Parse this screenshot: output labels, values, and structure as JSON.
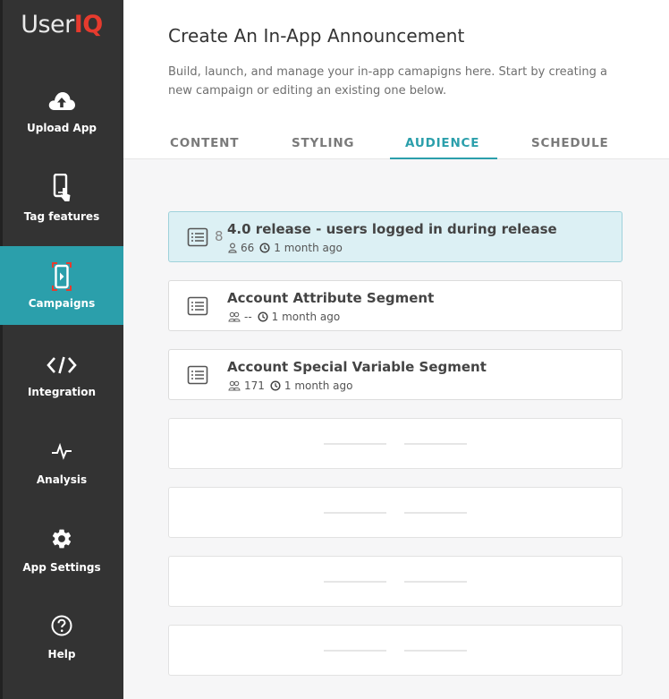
{
  "app": {
    "logo_part1": "User",
    "logo_part2": "IQ"
  },
  "sidebar": {
    "items": [
      {
        "label": "Upload App",
        "icon": "cloud-upload-icon"
      },
      {
        "label": "Tag features",
        "icon": "phone-tap-icon"
      },
      {
        "label": "Campaigns",
        "icon": "campaign-phone-icon",
        "active": true
      },
      {
        "label": "Integration",
        "icon": "code-icon"
      },
      {
        "label": "Analysis",
        "icon": "pulse-icon"
      },
      {
        "label": "App Settings",
        "icon": "gear-icon"
      },
      {
        "label": "Help",
        "icon": "help-icon"
      }
    ]
  },
  "header": {
    "title": "Create An In-App Announcement",
    "description": "Build, launch, and manage your in-app camapigns here. Start by creating a new campaign or editing an existing one below."
  },
  "tabs": [
    {
      "label": "CONTENT"
    },
    {
      "label": "STYLING"
    },
    {
      "label": "AUDIENCE",
      "active": true
    },
    {
      "label": "SCHEDULE"
    }
  ],
  "segments": [
    {
      "title": "4.0 release - users logged in during release",
      "count": "66",
      "time": "1 month ago",
      "selected": true,
      "side_glyph": "8"
    },
    {
      "title": "Account Attribute Segment",
      "count": "--",
      "time": "1 month ago"
    },
    {
      "title": "Account Special Variable Segment",
      "count": "171",
      "time": "1 month ago"
    }
  ],
  "colors": {
    "sidebar_bg": "#333333",
    "accent": "#2b9fab",
    "logo_accent": "#e63b2e",
    "selected_row_bg": "#dcf0f4"
  }
}
